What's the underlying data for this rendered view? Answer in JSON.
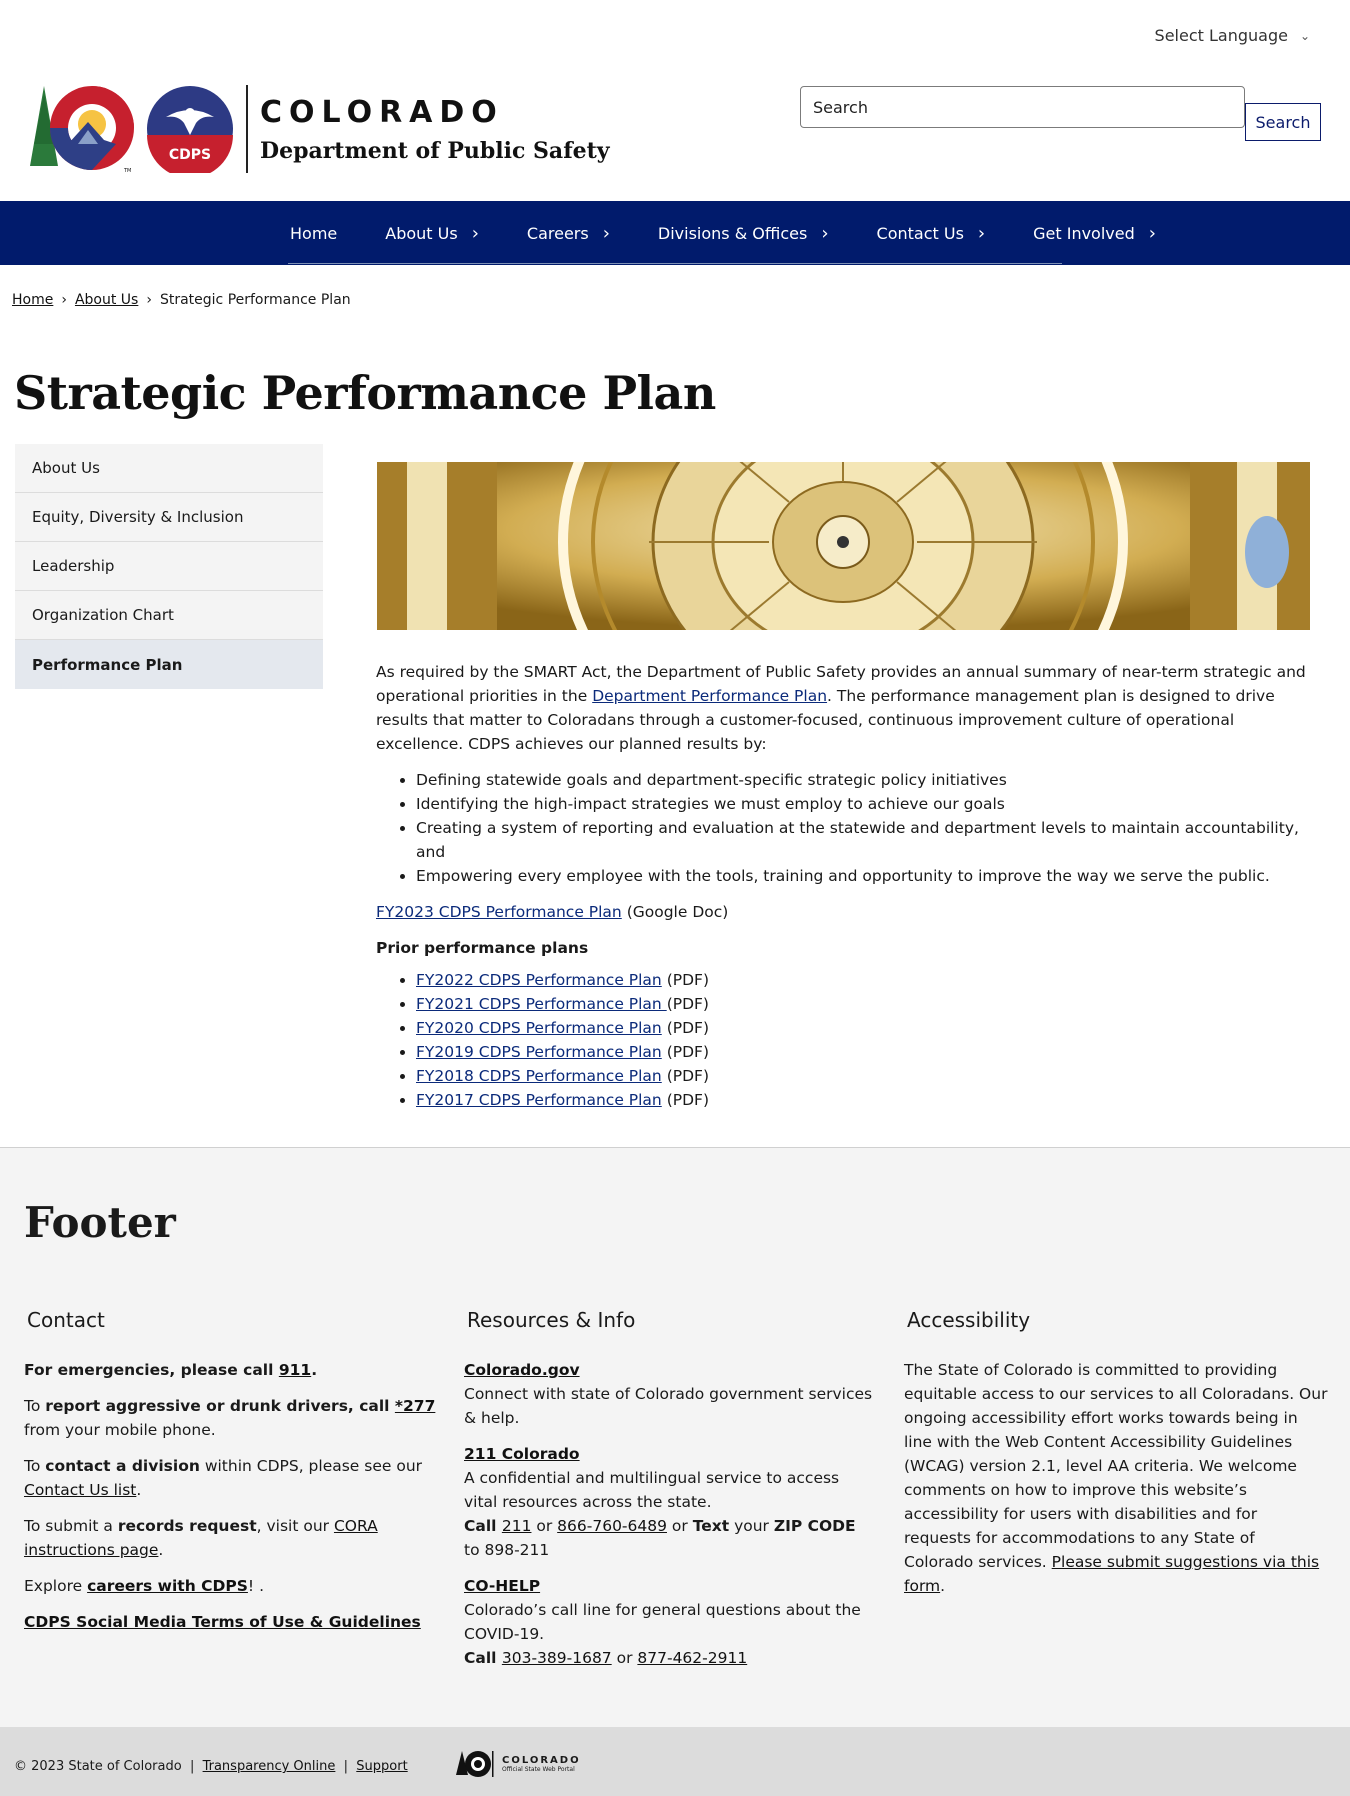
{
  "language": {
    "label": "Select Language"
  },
  "header": {
    "wordmark": "COLORADO",
    "department": "Department of Public Safety",
    "badge_text": "CDPS",
    "search_placeholder": "Search",
    "search_button": "Search"
  },
  "nav": {
    "items": [
      {
        "label": "Home",
        "caret": ""
      },
      {
        "label": "About Us",
        "caret": "›"
      },
      {
        "label": "Careers",
        "caret": "›"
      },
      {
        "label": "Divisions & Offices",
        "caret": "›"
      },
      {
        "label": "Contact Us",
        "caret": "›"
      },
      {
        "label": "Get Involved",
        "caret": "›"
      }
    ]
  },
  "breadcrumb": {
    "home": "Home",
    "sep": "›",
    "about": "About Us",
    "current": "Strategic Performance Plan"
  },
  "page_title": "Strategic Performance Plan",
  "sidenav": {
    "items": [
      "About Us",
      "Equity, Diversity & Inclusion",
      "Leadership",
      "Organization Chart",
      "Performance Plan"
    ]
  },
  "content": {
    "intro_before": "As required by the SMART Act, the Department of Public Safety provides an annual summary of near-term strategic and operational priorities in the ",
    "intro_link": "Department Performance Plan",
    "intro_after": ". The performance management plan is designed to drive results that matter to Coloradans through a customer-focused, continuous improvement culture of operational excellence. CDPS achieves our planned results by:",
    "bullets": [
      "Defining statewide goals and department-specific strategic policy initiatives",
      "Identifying the high-impact strategies we must employ to achieve our goals",
      "Creating a system of reporting and evaluation at the statewide and department levels to maintain accountability, and",
      "Empowering every employee with the tools, training and opportunity to improve the way we serve the public."
    ],
    "current_link": "FY2023 CDPS Performance Plan",
    "current_suffix": " (Google Doc)",
    "prior_label": "Prior performance plans",
    "prior": [
      {
        "link": "FY2022 CDPS Performance Plan",
        "suffix": " (PDF)"
      },
      {
        "link": "FY2021 CDPS Performance Plan ",
        "suffix": " (PDF)"
      },
      {
        "link": "FY2020 CDPS Performance Plan",
        "suffix": " (PDF)"
      },
      {
        "link": "FY2019 CDPS Performance Plan",
        "suffix": " (PDF)"
      },
      {
        "link": "FY2018 CDPS Performance Plan",
        "suffix": " (PDF)"
      },
      {
        "link": "FY2017 CDPS Performance Plan",
        "suffix": " (PDF)"
      }
    ]
  },
  "footer": {
    "heading": "Footer",
    "contact": {
      "title": "Contact",
      "emergency_text": "For emergencies, please call ",
      "emergency_num": "911",
      "emergency_end": ".",
      "drivers_pre": "To ",
      "drivers_bold": "report aggressive or drunk drivers, call ",
      "drivers_num": "*277",
      "drivers_post": " from your mobile phone.",
      "division_pre": "To ",
      "division_bold": "contact a division",
      "division_mid": " within CDPS, please see our ",
      "division_link": "Contact Us list",
      "division_end": ".",
      "records_pre": "To submit a ",
      "records_bold": "records request",
      "records_mid": ", visit our ",
      "records_link": "CORA instructions page",
      "records_end": ".",
      "careers_pre": "Explore ",
      "careers_link": "careers with CDPS",
      "careers_end": "! .",
      "social_link": "CDPS Social Media Terms of Use & Guidelines"
    },
    "resources": {
      "title": "Resources & Info",
      "co_gov": "Colorado.gov",
      "co_gov_desc": "Connect with state of Colorado government services & help.",
      "c211": "211 Colorado",
      "c211_desc": "A confidential and multilingual service to access vital resources across the state.",
      "call": "Call ",
      "num211": "211",
      "or": " or ",
      "num866": "866-760-6489",
      "text": "Text",
      "your": " your ",
      "zip": "ZIP CODE",
      "to": " to 898-211",
      "cohelp": "CO-HELP",
      "cohelp_desc": "Colorado’s call line for general questions about the COVID-19.",
      "num303": "303-389-1687",
      "num877": "877-462-2911"
    },
    "accessibility": {
      "title": "Accessibility",
      "text": "The State of Colorado is committed to providing equitable access to our services to all Coloradans. Our ongoing accessibility effort works towards being in line with the Web Content Accessibility Guidelines (WCAG) version 2.1, level AA criteria. We welcome comments on how to improve this website’s accessibility for users with disabilities and for requests for accommodations to any State of Colorado services. ",
      "link": "Please submit suggestions via this form",
      "end": "."
    }
  },
  "bottom": {
    "copyright": "© 2023 State of Colorado",
    "sep": "|",
    "transparency": "Transparency Online",
    "support": "Support",
    "portal_name": "COLORADO",
    "portal_sub": "Official State Web Portal"
  },
  "colors": {
    "nav_bg": "#011b6c",
    "link": "#0b2a7a",
    "footer_bg": "#f4f4f4"
  }
}
